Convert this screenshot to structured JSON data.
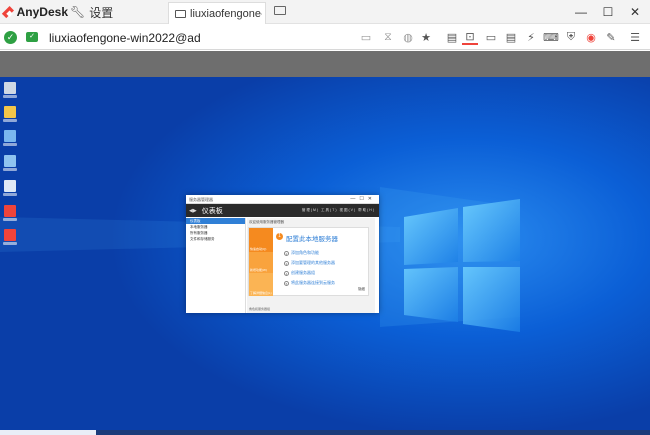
{
  "titlebar": {
    "app_name": "AnyDesk",
    "settings_tab": "设置",
    "session_tab": "liuxiaofengone-wi...",
    "icons": {
      "logo": "anydesk-logo-icon",
      "settings": "wrench-icon",
      "session": "monitor-icon",
      "new_tab": "monitor-icon"
    },
    "controls": {
      "minimize": "—",
      "maximize": "☐",
      "close": "✕"
    }
  },
  "addressbar": {
    "address": "liuxiaofengone-win2022@ad",
    "status_icons": [
      "connected-check-icon",
      "screen-ok-icon"
    ],
    "toolbar_icons": [
      "chat-icon",
      "hourglass-icon",
      "database-icon",
      "star-icon",
      "file-transfer-icon",
      "display-icon",
      "monitor-icon",
      "chat-bubble-icon",
      "actions-icon",
      "keyboard-icon",
      "permissions-icon",
      "record-icon",
      "pen-icon",
      "hamburger-menu-icon"
    ]
  },
  "accent_color": "#ef443b",
  "status_color": "#2ea043",
  "desktop": {
    "wallpaper": "windows-10-blue",
    "icons": [
      "recycle-bin-icon",
      "folder-icon",
      "this-pc-icon",
      "network-icon",
      "control-panel-icon",
      "anydesk-icon",
      "anydesk-icon"
    ]
  },
  "server_manager": {
    "window_title": "服务器管理器",
    "header_title": "仪表板",
    "header_menu": "管理(M)  工具(T)  视图(V)  帮助(H)",
    "nav": [
      "仪表板",
      "本地服务器",
      "所有服务器",
      "文件和存储服务"
    ],
    "main_heading": "欢迎使用服务器管理器",
    "welcome_title": "配置此本地服务器",
    "welcome_number": "1",
    "tiles": [
      "快速启动(Q)",
      "新增功能(W)",
      "了解详细信息(L)"
    ],
    "steps": [
      {
        "n": "2",
        "label": "添加角色和功能"
      },
      {
        "n": "3",
        "label": "添加要管理的其他服务器"
      },
      {
        "n": "4",
        "label": "创建服务器组"
      },
      {
        "n": "5",
        "label": "将此服务器连接到云服务"
      }
    ],
    "hide_label": "隐藏",
    "bottom_heading": "角色和服务器组"
  }
}
